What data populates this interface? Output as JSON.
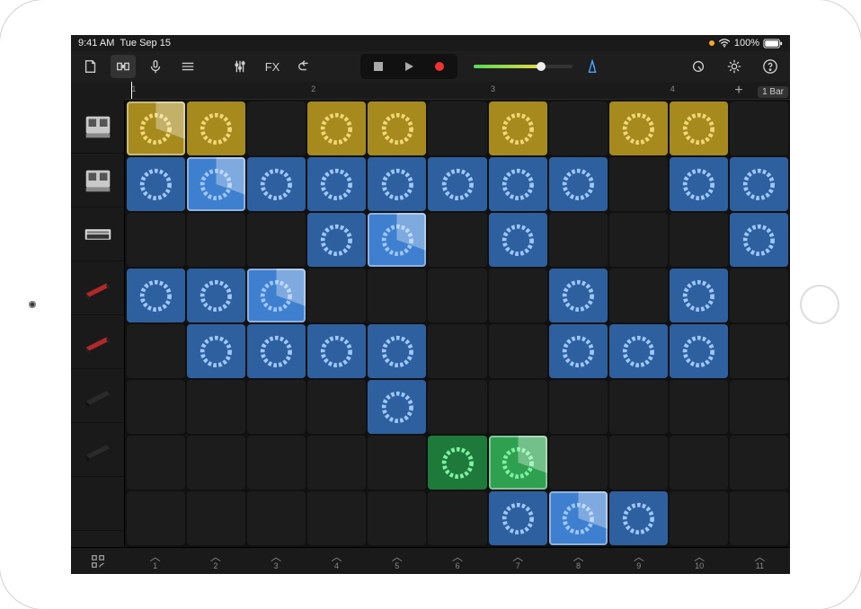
{
  "status": {
    "time": "9:41 AM",
    "date": "Tue Sep 15",
    "battery": "100%"
  },
  "toolbar": {
    "fx_label": "FX"
  },
  "ruler": {
    "bars": [
      "1",
      "2",
      "3",
      "4"
    ],
    "loop_length": "1 Bar",
    "add_label": "+"
  },
  "tracks": [
    {
      "id": "drum-machine-1",
      "kind": "drum"
    },
    {
      "id": "drum-machine-2",
      "kind": "drum"
    },
    {
      "id": "sampler",
      "kind": "sampler"
    },
    {
      "id": "keyboard-1",
      "kind": "keys-red"
    },
    {
      "id": "keyboard-2",
      "kind": "keys-red"
    },
    {
      "id": "keyboard-3",
      "kind": "keys-dark"
    },
    {
      "id": "keyboard-4",
      "kind": "keys-dark"
    },
    {
      "id": "extra",
      "kind": "empty"
    }
  ],
  "grid": {
    "cols": 11,
    "rows": 8,
    "cells": [
      {
        "r": 0,
        "c": 0,
        "color": "yellow",
        "playing": true
      },
      {
        "r": 0,
        "c": 1,
        "color": "yellow"
      },
      {
        "r": 0,
        "c": 3,
        "color": "yellow"
      },
      {
        "r": 0,
        "c": 4,
        "color": "yellow"
      },
      {
        "r": 0,
        "c": 6,
        "color": "yellow"
      },
      {
        "r": 0,
        "c": 8,
        "color": "yellow"
      },
      {
        "r": 0,
        "c": 9,
        "color": "yellow"
      },
      {
        "r": 1,
        "c": 0,
        "color": "blue"
      },
      {
        "r": 1,
        "c": 1,
        "color": "blue",
        "playing": true
      },
      {
        "r": 1,
        "c": 2,
        "color": "blue"
      },
      {
        "r": 1,
        "c": 3,
        "color": "blue"
      },
      {
        "r": 1,
        "c": 4,
        "color": "blue"
      },
      {
        "r": 1,
        "c": 5,
        "color": "blue"
      },
      {
        "r": 1,
        "c": 6,
        "color": "blue"
      },
      {
        "r": 1,
        "c": 7,
        "color": "blue"
      },
      {
        "r": 1,
        "c": 9,
        "color": "blue"
      },
      {
        "r": 1,
        "c": 10,
        "color": "blue"
      },
      {
        "r": 2,
        "c": 3,
        "color": "blue"
      },
      {
        "r": 2,
        "c": 4,
        "color": "blue",
        "playing": true
      },
      {
        "r": 2,
        "c": 6,
        "color": "blue"
      },
      {
        "r": 2,
        "c": 10,
        "color": "blue"
      },
      {
        "r": 3,
        "c": 0,
        "color": "blue"
      },
      {
        "r": 3,
        "c": 1,
        "color": "blue"
      },
      {
        "r": 3,
        "c": 2,
        "color": "blue",
        "playing": true
      },
      {
        "r": 3,
        "c": 7,
        "color": "blue"
      },
      {
        "r": 3,
        "c": 9,
        "color": "blue"
      },
      {
        "r": 4,
        "c": 1,
        "color": "blue"
      },
      {
        "r": 4,
        "c": 2,
        "color": "blue"
      },
      {
        "r": 4,
        "c": 3,
        "color": "blue"
      },
      {
        "r": 4,
        "c": 4,
        "color": "blue"
      },
      {
        "r": 4,
        "c": 7,
        "color": "blue"
      },
      {
        "r": 4,
        "c": 8,
        "color": "blue"
      },
      {
        "r": 4,
        "c": 9,
        "color": "blue"
      },
      {
        "r": 5,
        "c": 4,
        "color": "blue"
      },
      {
        "r": 6,
        "c": 5,
        "color": "green"
      },
      {
        "r": 6,
        "c": 6,
        "color": "green",
        "playing": true
      },
      {
        "r": 7,
        "c": 6,
        "color": "blue"
      },
      {
        "r": 7,
        "c": 7,
        "color": "blue",
        "playing": true
      },
      {
        "r": 7,
        "c": 8,
        "color": "blue"
      }
    ]
  },
  "columns": [
    "1",
    "2",
    "3",
    "4",
    "5",
    "6",
    "7",
    "8",
    "9",
    "10",
    "11"
  ]
}
